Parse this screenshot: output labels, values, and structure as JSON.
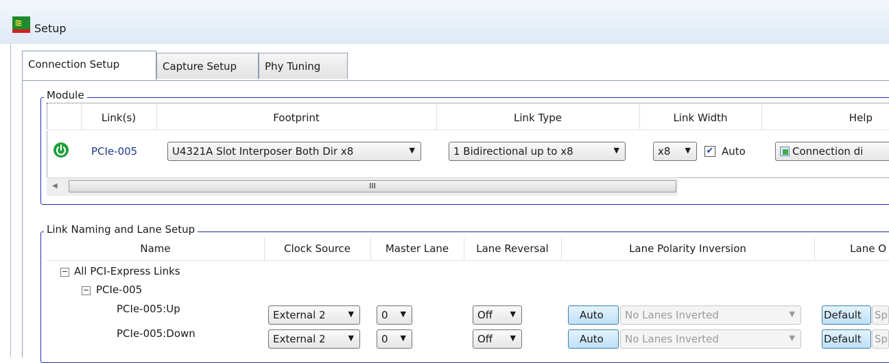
{
  "window": {
    "title": "Setup"
  },
  "tabs": [
    "Connection Setup",
    "Capture Setup",
    "Phy Tuning"
  ],
  "module": {
    "legend": "Module",
    "headers": {
      "links": "Link(s)",
      "footprint": "Footprint",
      "link_type": "Link Type",
      "link_width": "Link Width",
      "help": "Help"
    },
    "row": {
      "link": "PCIe-005",
      "footprint": "U4321A Slot Interposer Both Dir x8",
      "link_type": "1 Bidirectional up to x8",
      "width": "x8",
      "auto_label": "Auto",
      "auto_checked": true,
      "help_button": "Connection di"
    },
    "scrollbar_grip": "III"
  },
  "naming": {
    "legend": "Link Naming and Lane Setup",
    "headers": {
      "name": "Name",
      "clock": "Clock Source",
      "master": "Master Lane",
      "reversal": "Lane Reversal",
      "polarity": "Lane Polarity Inversion",
      "order": "Lane O"
    },
    "tree_root": "All PCI-Express Links",
    "tree_child": "PCIe-005",
    "rows": [
      {
        "name": "PCIe-005:Up",
        "clock": "External 2",
        "master": "0",
        "reversal": "Off",
        "auto": "Auto",
        "polarity": "No Lanes Inverted",
        "default": "Default",
        "extra": "Sp"
      },
      {
        "name": "PCIe-005:Down",
        "clock": "External 2",
        "master": "0",
        "reversal": "Off",
        "auto": "Auto",
        "polarity": "No Lanes Inverted",
        "default": "Default",
        "extra": "Sp"
      }
    ]
  },
  "colors": {
    "accent": "#1f2fb5",
    "power": "#1e9e3a",
    "link_text": "#1a3a8a"
  }
}
